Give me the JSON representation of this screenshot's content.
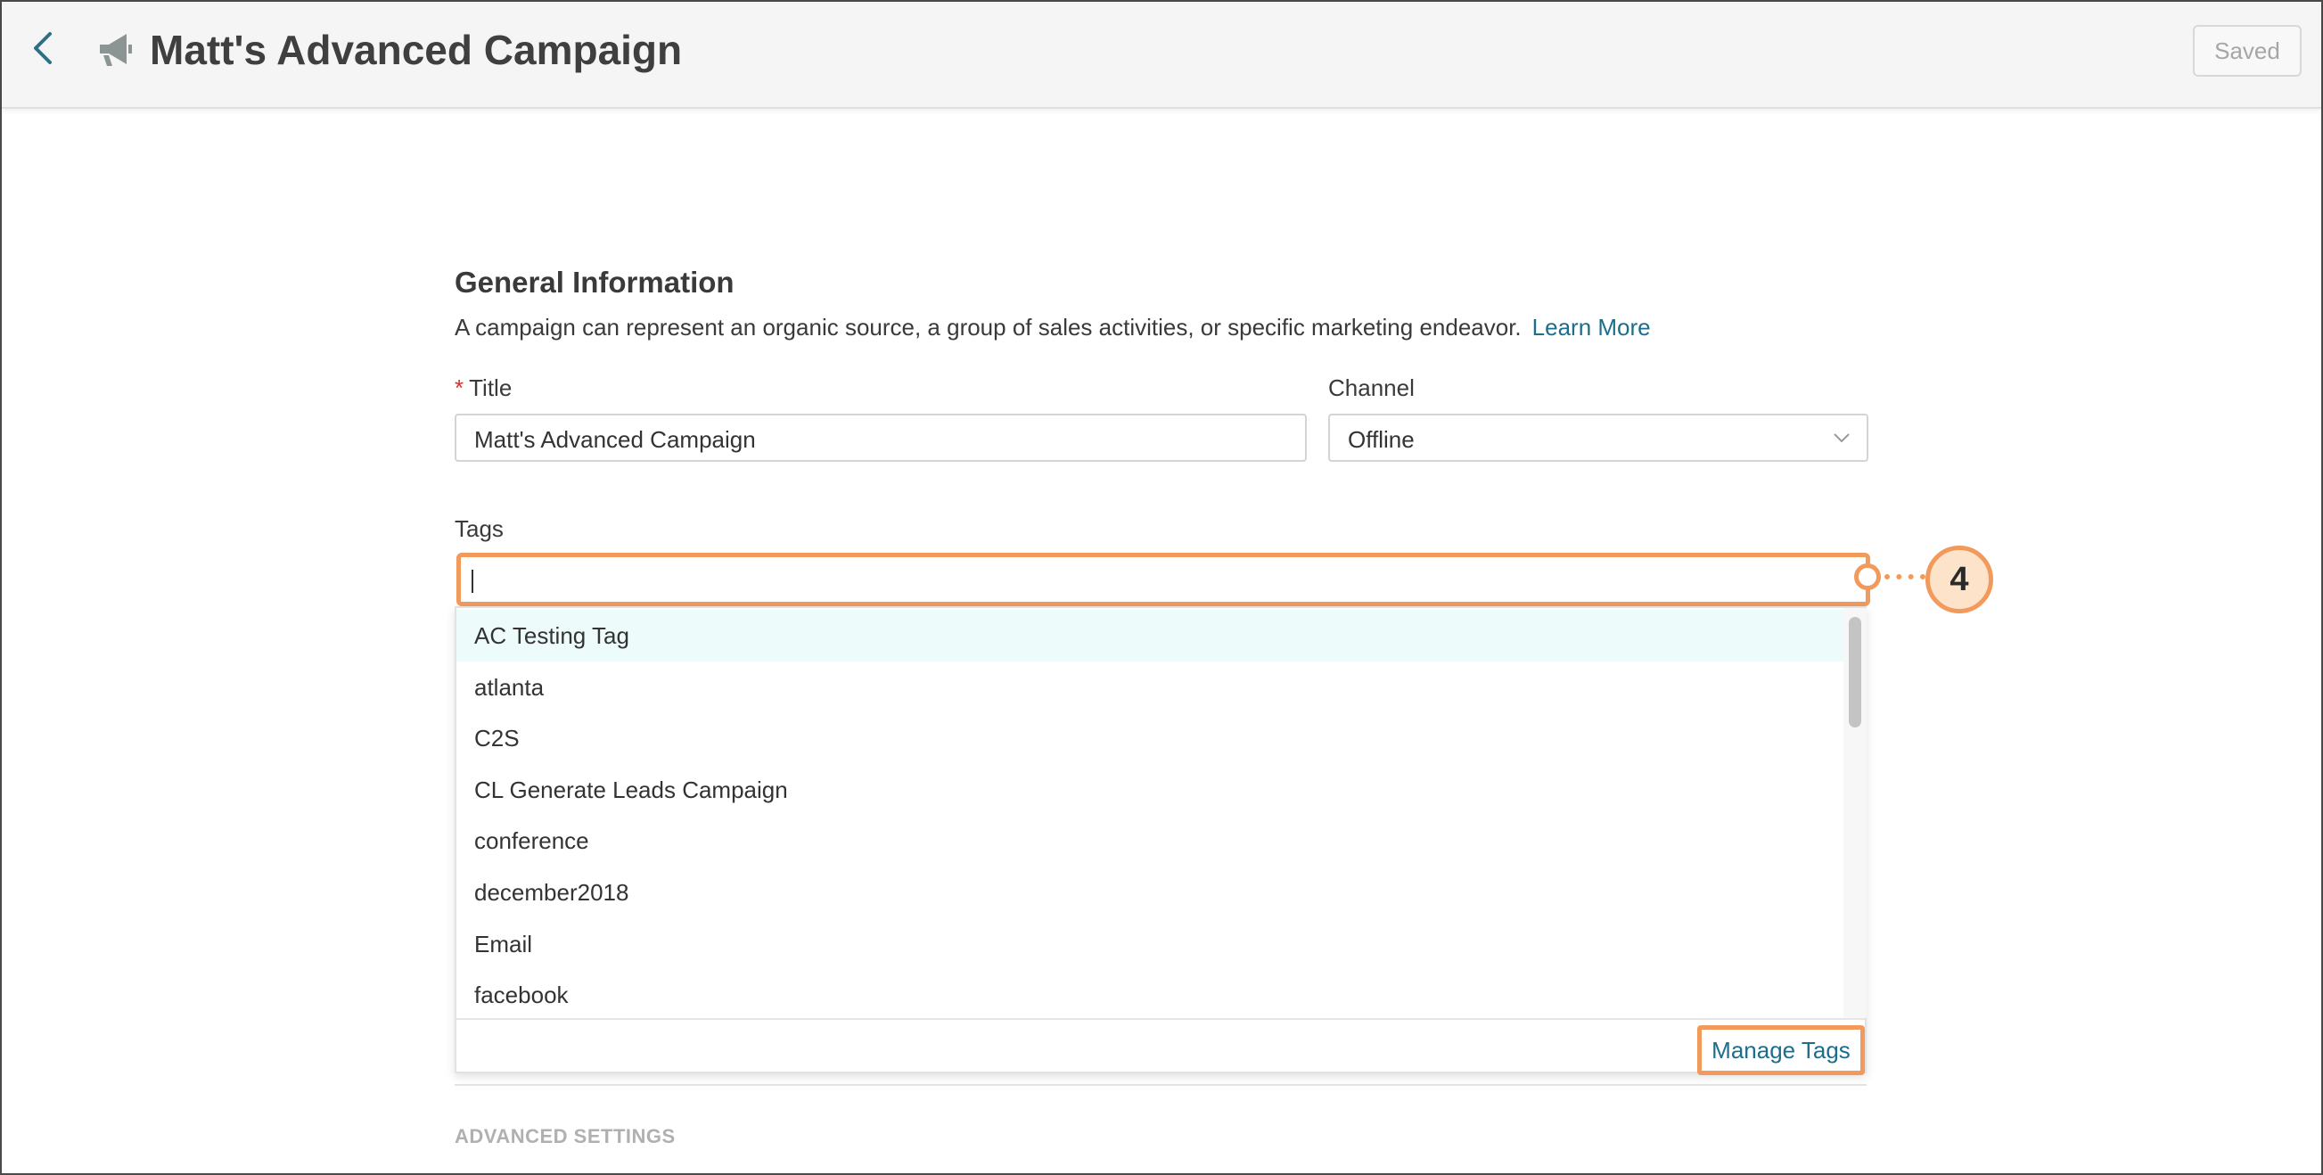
{
  "header": {
    "title": "Matt's Advanced Campaign",
    "saved_label": "Saved",
    "back_icon": "chevron-left-icon",
    "campaign_icon": "megaphone-icon"
  },
  "general": {
    "heading": "General Information",
    "description": "A campaign can represent an organic source, a group of sales activities, or specific marketing endeavor.",
    "learn_more": "Learn More"
  },
  "fields": {
    "title": {
      "required_mark": "*",
      "label": "Title",
      "value": "Matt's Advanced Campaign"
    },
    "channel": {
      "label": "Channel",
      "value": "Offline"
    },
    "tags": {
      "label": "Tags",
      "value": ""
    }
  },
  "tags_dropdown": {
    "options": [
      "AC Testing Tag",
      "atlanta",
      "C2S",
      "CL Generate Leads Campaign",
      "conference",
      "december2018",
      "Email",
      "facebook"
    ],
    "highlighted_index": 0,
    "manage_label": "Manage Tags"
  },
  "callout": {
    "number": "4"
  },
  "advanced": {
    "label": "ADVANCED SETTINGS"
  },
  "colors": {
    "accent_link": "#1c6e8c",
    "highlight": "#f29a5c",
    "required": "#d9302c"
  }
}
